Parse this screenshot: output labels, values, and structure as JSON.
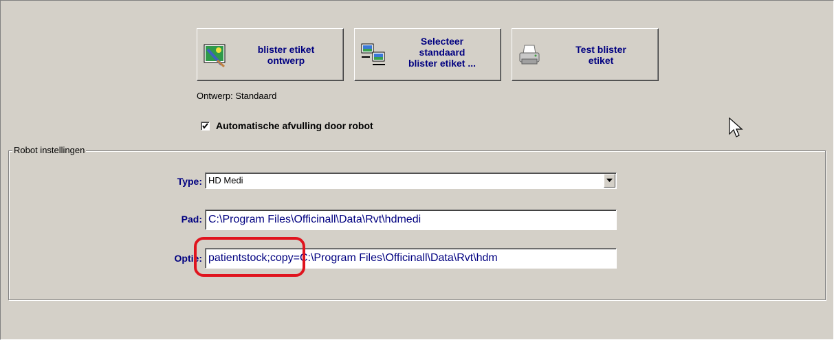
{
  "toolbar": {
    "design_button": {
      "line1": "blister etiket",
      "line2": "ontwerp",
      "icon": "paint-brush-icon"
    },
    "select_button": {
      "line1": "Selecteer",
      "line2": "standaard",
      "line3": "blister etiket ...",
      "icon": "select-template-icon"
    },
    "test_button": {
      "line1": "Test blister",
      "line2": "etiket",
      "icon": "printer-icon"
    }
  },
  "design_caption": "Ontwerp: Standaard",
  "auto_fill": {
    "label": "Automatische afvulling door robot",
    "checked": true
  },
  "robot_group": {
    "legend": "Robot instellingen",
    "type": {
      "label": "Type:",
      "value": "HD Medi"
    },
    "path": {
      "label": "Pad:",
      "value": "C:\\Program Files\\Officinall\\Data\\Rvt\\hdmedi"
    },
    "options": {
      "label": "Optie:",
      "value": "patientstock;copy=C:\\Program Files\\Officinall\\Data\\Rvt\\hdm"
    }
  },
  "colors": {
    "accent": "#000080",
    "highlight": "#e0141e",
    "background": "#d4d0c8"
  }
}
